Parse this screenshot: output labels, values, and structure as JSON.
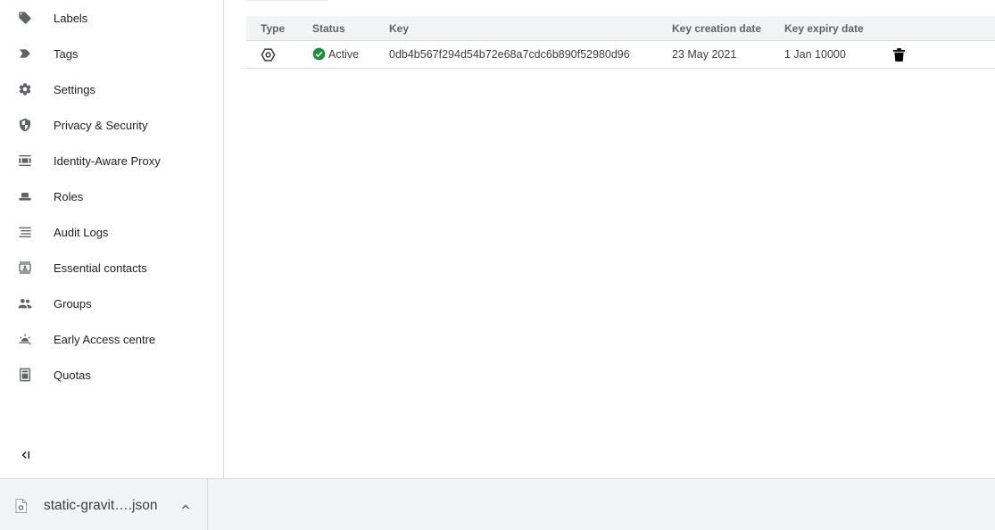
{
  "sidebar": {
    "items": [
      {
        "label": "Labels",
        "icon": "label-icon"
      },
      {
        "label": "Tags",
        "icon": "tag-icon"
      },
      {
        "label": "Settings",
        "icon": "gear-icon"
      },
      {
        "label": "Privacy & Security",
        "icon": "shield-icon"
      },
      {
        "label": "Identity-Aware Proxy",
        "icon": "proxy-icon"
      },
      {
        "label": "Roles",
        "icon": "hat-icon"
      },
      {
        "label": "Audit Logs",
        "icon": "list-icon"
      },
      {
        "label": "Essential contacts",
        "icon": "contact-card-icon"
      },
      {
        "label": "Groups",
        "icon": "people-icon"
      },
      {
        "label": "Early Access centre",
        "icon": "early-access-icon"
      },
      {
        "label": "Quotas",
        "icon": "quota-icon"
      }
    ],
    "collapse_icon": "collapse-sidebar-icon"
  },
  "keys_table": {
    "headers": {
      "type": "Type",
      "status": "Status",
      "key": "Key",
      "created": "Key creation date",
      "expiry": "Key expiry date"
    },
    "rows": [
      {
        "type_icon": "key-type-icon",
        "status": "Active",
        "key": "0db4b567f294d54b72e68a7cdc6b890f52980d96",
        "created": "23 May 2021",
        "expiry": "1 Jan 10000"
      }
    ]
  },
  "download_bar": {
    "filename": "static-gravit….json",
    "file_icon": "file-icon",
    "chevron_icon": "chevron-up-icon"
  },
  "colors": {
    "active_green": "#1e8e3e",
    "icon_gray": "#5f6368",
    "header_bg": "#f1f3f4",
    "border": "#dadce0"
  }
}
